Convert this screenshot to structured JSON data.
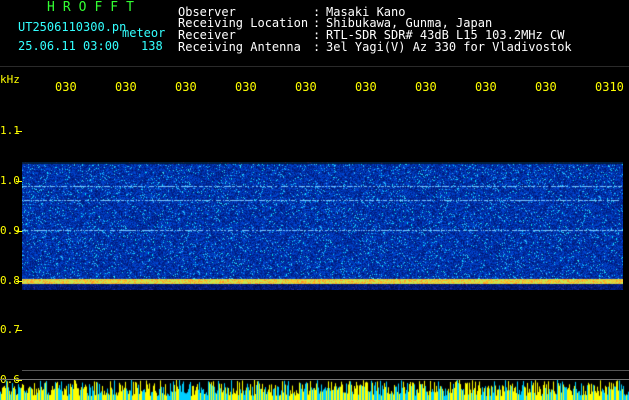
{
  "station": {
    "title": "HROFFT",
    "filename": "UT2506110300.pn",
    "tag": "meteor",
    "datetime": "25.06.11 03:00",
    "count": "138"
  },
  "info": [
    {
      "label": "Observer",
      "value": "Masaki Kano"
    },
    {
      "label": "Receiving Location",
      "value": "Shibukawa, Gunma, Japan"
    },
    {
      "label": "Receiver",
      "value": "RTL-SDR SDR# 43dB L15 103.2MHz CW"
    },
    {
      "label": "Receiving Antenna",
      "value": "3el Yagi(V) Az 330 for Vladivostok"
    }
  ],
  "separator": ":",
  "axis": {
    "y_unit": "kHz",
    "y_ticks": [
      "1.1",
      "1.0",
      "0.9",
      "0.8",
      "0.7",
      "0.6"
    ],
    "x_ticks": [
      "030",
      "030",
      "030",
      "030",
      "030",
      "030",
      "030",
      "030",
      "030",
      "0310"
    ]
  },
  "colors": {
    "text_header_title": "#33ff33",
    "text_info": "#33ffff",
    "axis": "#ffff00",
    "spectrum_bg": "#0a1a8c",
    "carrier_line": "#ff3030"
  }
}
